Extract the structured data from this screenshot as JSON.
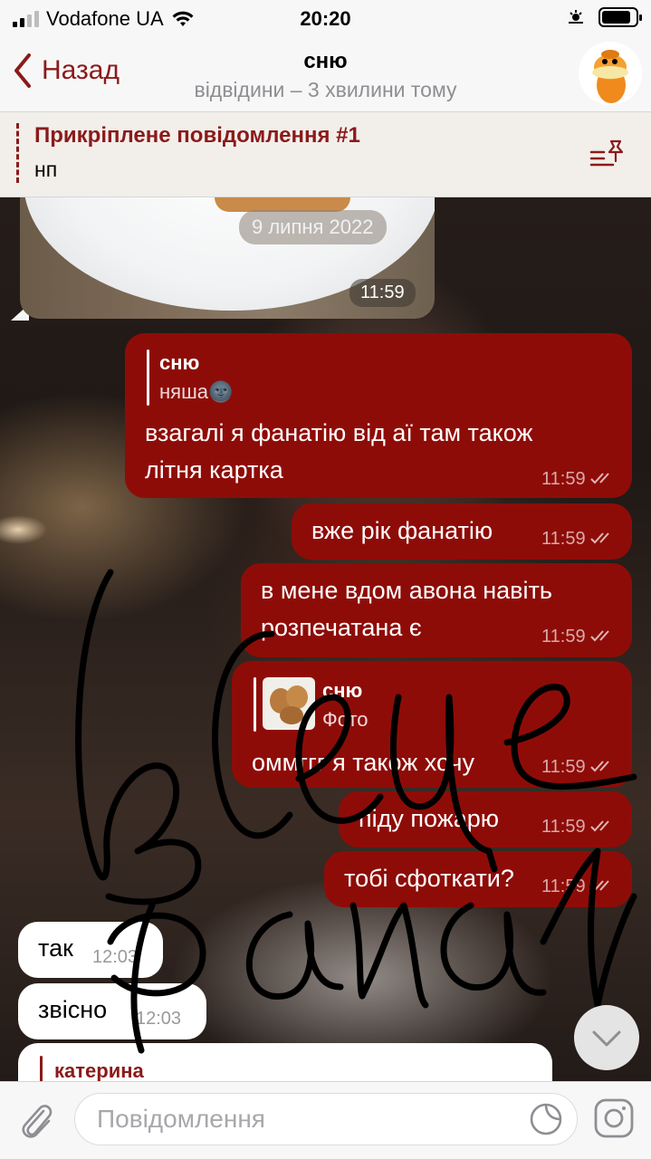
{
  "status_bar": {
    "carrier": "Vodafone UA",
    "time": "20:20",
    "battery_fraction": 0.85
  },
  "header": {
    "back_label": "Назад",
    "title": "сню",
    "subtitle": "відвідини – 3 хвилини тому"
  },
  "pinned": {
    "title": "Прикріплене повідомлення #1",
    "text": "нп"
  },
  "photo_message": {
    "date": "9 липня 2022",
    "time": "11:59"
  },
  "messages": [
    {
      "reply_name": "сню",
      "reply_text": "няша🌚",
      "line1": "взагалі я фанатію від аї там також",
      "line2": "літня картка",
      "time": "11:59"
    },
    {
      "text": "вже рік фанатію",
      "time": "11:59"
    },
    {
      "line1": "в мене вдом авона навіть",
      "line2": "розпечатана є",
      "time": "11:59"
    },
    {
      "reply_name": "сню",
      "reply_text": "Фото",
      "text": "оммггг я також хочу",
      "time": "11:59"
    },
    {
      "text": "піду пожарю",
      "time": "11:59"
    },
    {
      "text": "тобі сфоткати?",
      "time": "11:59"
    }
  ],
  "incoming": [
    {
      "text": "так",
      "time": "12:03"
    },
    {
      "text": "звісно",
      "time": "12:03"
    },
    {
      "reply_name": "катерина"
    }
  ],
  "input": {
    "placeholder": "Повідомлення"
  },
  "colors": {
    "accent": "#8b1a1a",
    "bubble_out": "#8e0c08",
    "bubble_in": "#ffffff"
  },
  "icons": [
    "signal-icon",
    "wifi-icon",
    "location-icon",
    "battery-icon",
    "back-chevron-icon",
    "pin-list-icon",
    "double-check-icon",
    "chevron-down-icon",
    "paperclip-icon",
    "sticker-icon",
    "instagram-icon"
  ]
}
